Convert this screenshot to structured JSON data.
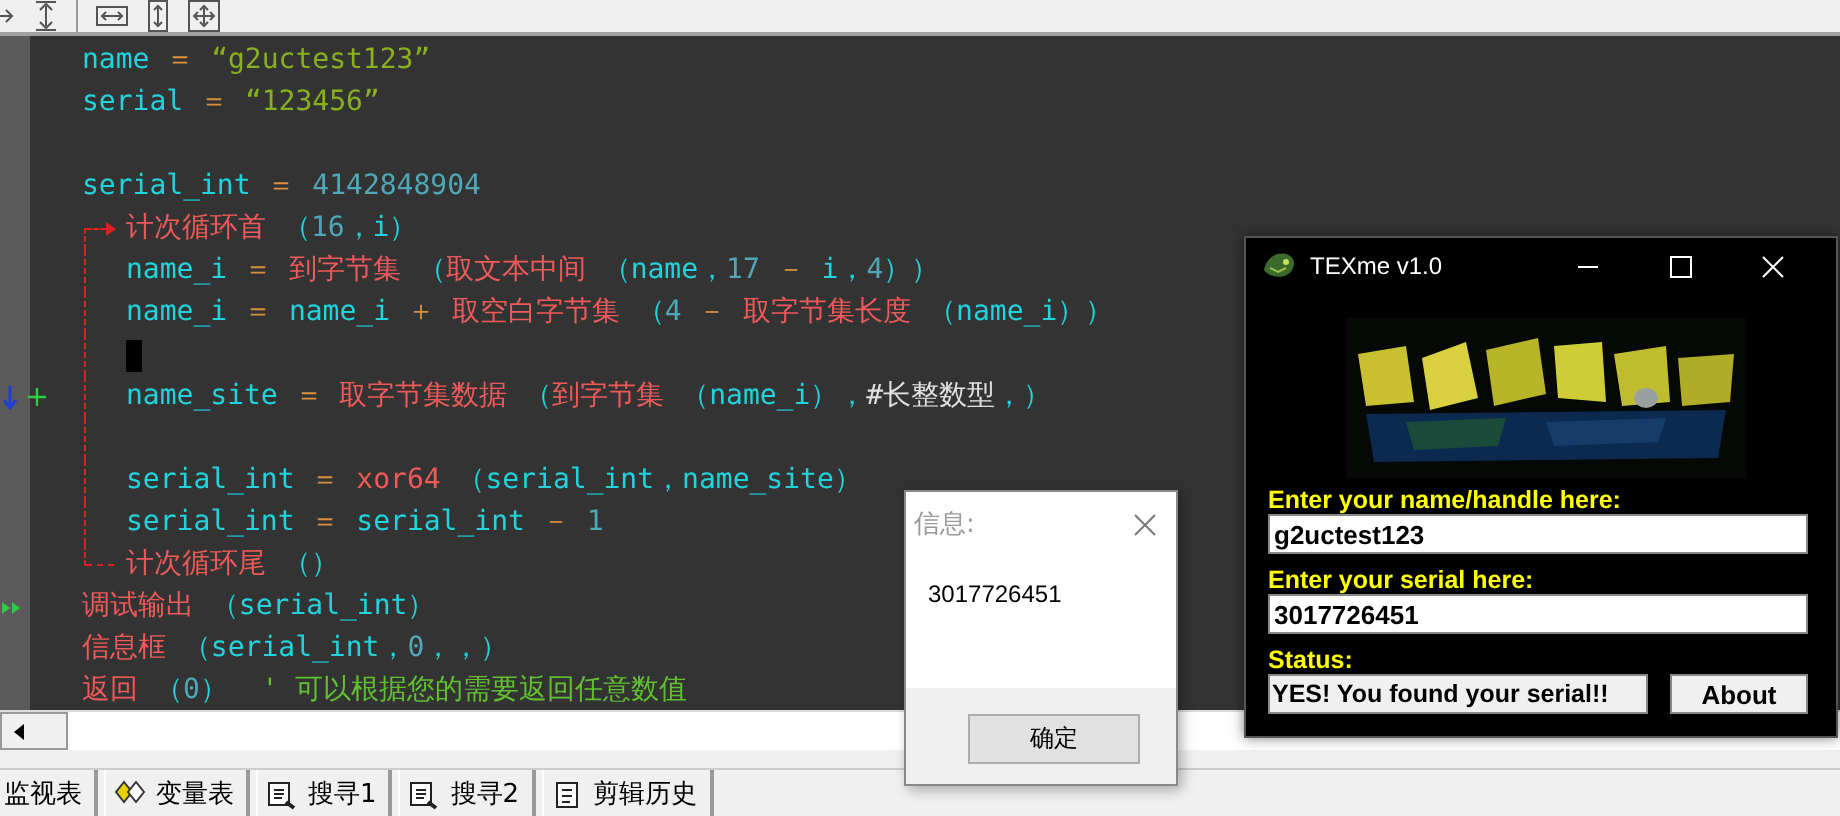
{
  "editor": {
    "lines": [
      {
        "kind": "code",
        "tokens": [
          {
            "kind": "ident",
            "text": "name"
          },
          {
            "kind": "op",
            "text": " ＝ "
          },
          {
            "kind": "string",
            "text": "“g2uctest123”"
          }
        ]
      },
      {
        "kind": "code",
        "tokens": [
          {
            "kind": "ident",
            "text": "serial"
          },
          {
            "kind": "op",
            "text": " ＝ "
          },
          {
            "kind": "string",
            "text": "“123456”"
          }
        ]
      },
      {
        "kind": "blank"
      },
      {
        "kind": "code",
        "tokens": [
          {
            "kind": "ident",
            "text": "serial_int"
          },
          {
            "kind": "op",
            "text": " ＝ "
          },
          {
            "kind": "number",
            "text": "4142848904"
          }
        ]
      },
      {
        "kind": "loop",
        "tokens": [
          {
            "kind": "func",
            "text": "计次循环首"
          },
          {
            "kind": "punct",
            "text": " （"
          },
          {
            "kind": "number",
            "text": "16"
          },
          {
            "kind": "punct",
            "text": "，"
          },
          {
            "kind": "ident",
            "text": "i"
          },
          {
            "kind": "punct",
            "text": "）"
          }
        ],
        "children": [
          {
            "kind": "code",
            "tokens": [
              {
                "kind": "ident",
                "text": "name_i"
              },
              {
                "kind": "op",
                "text": " ＝ "
              },
              {
                "kind": "func",
                "text": "到字节集"
              },
              {
                "kind": "punct",
                "text": " （"
              },
              {
                "kind": "func",
                "text": "取文本中间"
              },
              {
                "kind": "punct",
                "text": " （"
              },
              {
                "kind": "ident",
                "text": "name"
              },
              {
                "kind": "punct",
                "text": "，"
              },
              {
                "kind": "number",
                "text": "17"
              },
              {
                "kind": "op",
                "text": " － "
              },
              {
                "kind": "ident",
                "text": "i"
              },
              {
                "kind": "punct",
                "text": "，"
              },
              {
                "kind": "number",
                "text": "4"
              },
              {
                "kind": "punct",
                "text": "））"
              }
            ]
          },
          {
            "kind": "code",
            "tokens": [
              {
                "kind": "ident",
                "text": "name_i"
              },
              {
                "kind": "op",
                "text": " ＝ "
              },
              {
                "kind": "ident",
                "text": "name_i"
              },
              {
                "kind": "op",
                "text": " ＋ "
              },
              {
                "kind": "func",
                "text": "取空白字节集"
              },
              {
                "kind": "punct",
                "text": " （"
              },
              {
                "kind": "number",
                "text": "4"
              },
              {
                "kind": "op",
                "text": " － "
              },
              {
                "kind": "func",
                "text": "取字节集长度"
              },
              {
                "kind": "punct",
                "text": " （"
              },
              {
                "kind": "ident",
                "text": "name_i"
              },
              {
                "kind": "punct",
                "text": "））"
              }
            ]
          },
          {
            "kind": "cursor"
          },
          {
            "kind": "code",
            "gutter": {
              "kind": "step"
            },
            "tokens": [
              {
                "kind": "ident",
                "text": "name_site"
              },
              {
                "kind": "op",
                "text": " ＝ "
              },
              {
                "kind": "func",
                "text": "取字节集数据"
              },
              {
                "kind": "punct",
                "text": " （"
              },
              {
                "kind": "func",
                "text": "到字节集"
              },
              {
                "kind": "punct",
                "text": " （"
              },
              {
                "kind": "ident",
                "text": "name_i"
              },
              {
                "kind": "punct",
                "text": "），"
              },
              {
                "kind": "const",
                "text": "#长整数型"
              },
              {
                "kind": "punct",
                "text": "，）"
              }
            ]
          },
          {
            "kind": "blank"
          },
          {
            "kind": "code",
            "tokens": [
              {
                "kind": "ident",
                "text": "serial_int"
              },
              {
                "kind": "op",
                "text": " ＝ "
              },
              {
                "kind": "func",
                "text": "xor64"
              },
              {
                "kind": "punct",
                "text": " （serial_int，name_site）"
              }
            ]
          },
          {
            "kind": "code",
            "tokens": [
              {
                "kind": "ident",
                "text": "serial_int"
              },
              {
                "kind": "op",
                "text": " ＝ "
              },
              {
                "kind": "ident",
                "text": "serial_int"
              },
              {
                "kind": "op",
                "text": " － "
              },
              {
                "kind": "number",
                "text": "1"
              }
            ]
          }
        ],
        "end_tokens": [
          {
            "kind": "func",
            "text": "计次循环尾"
          },
          {
            "kind": "punct",
            "text": " （）"
          }
        ]
      },
      {
        "kind": "code",
        "gutter": {
          "kind": "run"
        },
        "tokens": [
          {
            "kind": "func",
            "text": "调试输出"
          },
          {
            "kind": "punct",
            "text": " （serial_int）"
          }
        ]
      },
      {
        "kind": "code",
        "tokens": [
          {
            "kind": "func",
            "text": "信息框"
          },
          {
            "kind": "punct",
            "text": " （serial_int，"
          },
          {
            "kind": "number",
            "text": "0"
          },
          {
            "kind": "punct",
            "text": "，，）"
          }
        ]
      },
      {
        "kind": "code",
        "tokens": [
          {
            "kind": "func",
            "text": "返回"
          },
          {
            "kind": "punct",
            "text": " （"
          },
          {
            "kind": "number",
            "text": "0"
          },
          {
            "kind": "punct",
            "text": "）"
          },
          {
            "kind": "comment",
            "text": "  ' 可以根据您的需要返回任意数值"
          }
        ]
      }
    ]
  },
  "bottom_tabs": [
    {
      "label": "监视表",
      "kind": "plain"
    },
    {
      "label": "变量表",
      "kind": "variables"
    },
    {
      "label": "搜寻1",
      "kind": "search"
    },
    {
      "label": "搜寻2",
      "kind": "search"
    },
    {
      "label": "剪辑历史",
      "kind": "history"
    }
  ],
  "message_box": {
    "title": "信息:",
    "text": "3017726451",
    "button": "确定"
  },
  "texme": {
    "title": "TEXme v1.0",
    "name_label": "Enter your name/handle here:",
    "name_value": "g2uctest123",
    "serial_label": "Enter your serial here:",
    "serial_value": "3017726451",
    "status_label": "Status:",
    "status_value": "YES! You found your serial!!",
    "about_button": "About"
  }
}
